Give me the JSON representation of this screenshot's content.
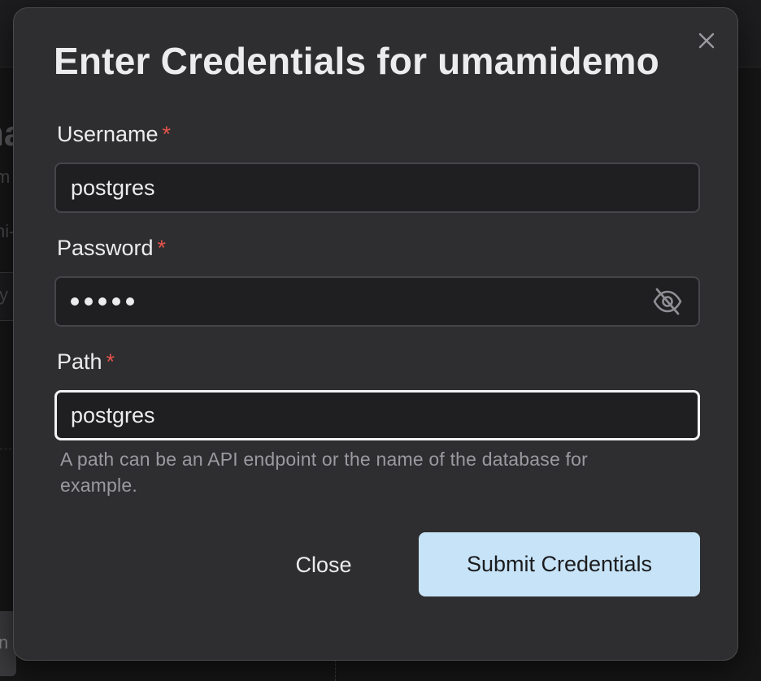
{
  "dialog": {
    "title": "Enter Credentials for umamidemo",
    "close_icon": "close-x-icon"
  },
  "fields": {
    "username": {
      "label": "Username",
      "required_mark": "*",
      "value": "postgres"
    },
    "password": {
      "label": "Password",
      "required_mark": "*",
      "masked_length": 5,
      "toggle_icon": "eye-off-icon"
    },
    "path": {
      "label": "Path",
      "required_mark": "*",
      "value": "postgres",
      "helper_text": "A path can be an API endpoint or the name of the database for example."
    }
  },
  "actions": {
    "close_label": "Close",
    "submit_label": "Submit Credentials"
  },
  "colors": {
    "modal_bg": "#2e2e30",
    "required": "#e5534b",
    "submit_bg": "#c7e3f7",
    "focus_border": "#f2f2f4"
  }
}
